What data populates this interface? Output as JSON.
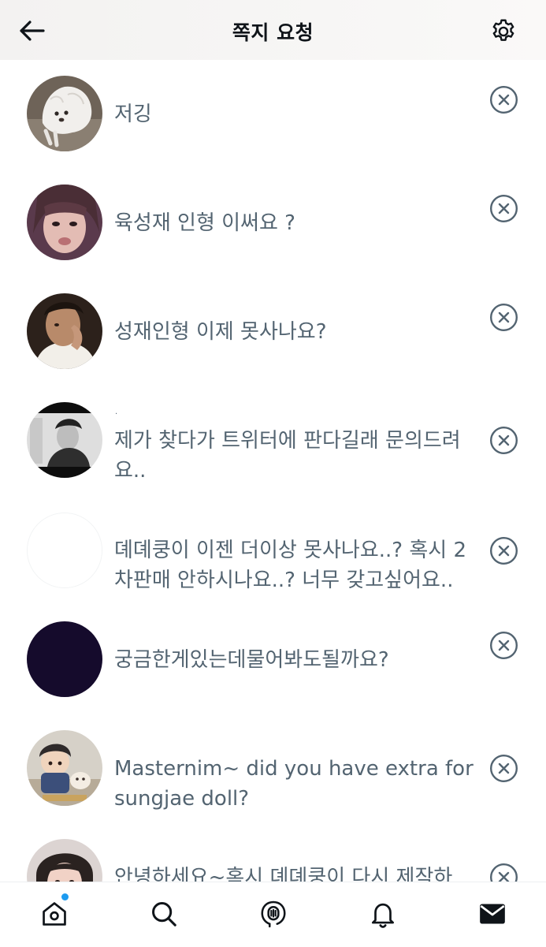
{
  "header": {
    "title": "쪽지 요청",
    "back_icon": "arrow-left-icon",
    "settings_icon": "gear-icon"
  },
  "requests": [
    {
      "message": "저깅",
      "avatar": "white-fluffy-dog"
    },
    {
      "message": "육성재 인형 이써요 ?",
      "avatar": "woman-selfie"
    },
    {
      "message": "성재인형 이제 못사나요?",
      "avatar": "man-hand-on-face"
    },
    {
      "message": "제가 찾다가 트위터에 판다길래 문의드려\n요..",
      "avatar": "monochrome-photo",
      "display_name": "."
    },
    {
      "message": "뎨뎨쿵이 이젠 더이상 못사나요..? 혹시 2\n차판매 안하시나요..? 너무 갖고싶어요..",
      "avatar": "blank-white"
    },
    {
      "message": "궁금한게있는데물어봐도될까요?",
      "avatar": "dark-navy"
    },
    {
      "message": "Masternim~ did you have extra for\nsungjae doll?",
      "avatar": "doll-figure"
    },
    {
      "message": "안녕하세요~혹시 뎨뎨쿵이 다시 제작하",
      "avatar": "girl-portrait"
    }
  ],
  "tabbar": {
    "items": [
      "home-icon",
      "search-icon",
      "spaces-icon",
      "notifications-icon",
      "messages-icon"
    ],
    "active": "messages-icon",
    "accent_color": "#1d9bf0"
  },
  "colors": {
    "text_primary": "#0f1419",
    "text_secondary": "#536471",
    "icon": "#536471"
  }
}
